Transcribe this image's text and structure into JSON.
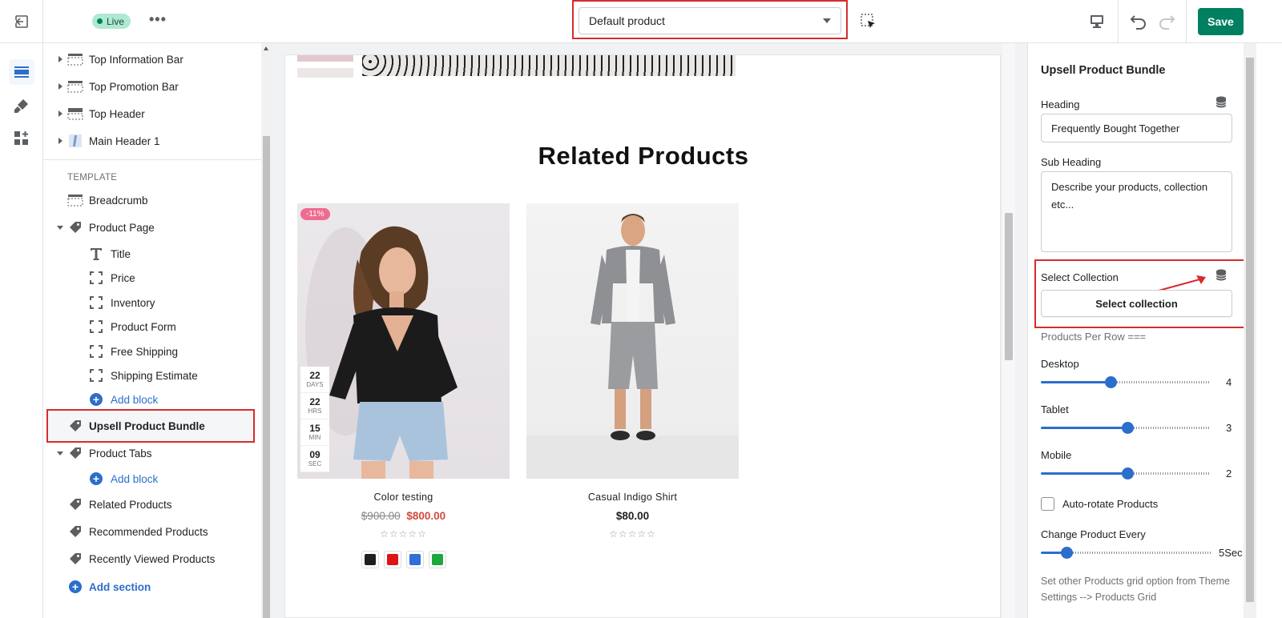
{
  "topbar": {
    "live_label": "Live",
    "more_label": "•••",
    "product_select_value": "Default product",
    "save_label": "Save"
  },
  "sidebar": {
    "header_items": [
      {
        "label": "Top Information Bar"
      },
      {
        "label": "Top Promotion Bar"
      },
      {
        "label": "Top Header"
      },
      {
        "label": "Main Header 1"
      }
    ],
    "template_heading": "TEMPLATE",
    "breadcrumb_label": "Breadcrumb",
    "product_page_label": "Product Page",
    "product_page_blocks": [
      {
        "label": "Title",
        "icon": "text-icon"
      },
      {
        "label": "Price",
        "icon": "block-icon"
      },
      {
        "label": "Inventory",
        "icon": "block-icon"
      },
      {
        "label": "Product Form",
        "icon": "block-icon"
      },
      {
        "label": "Free Shipping",
        "icon": "block-icon"
      },
      {
        "label": "Shipping Estimate",
        "icon": "block-icon"
      }
    ],
    "add_block_label": "Add block",
    "upsell_label": "Upsell Product Bundle",
    "product_tabs_label": "Product Tabs",
    "add_block_label_2": "Add block",
    "related_label": "Related Products",
    "recommended_label": "Recommended Products",
    "recently_viewed_label": "Recently Viewed Products",
    "add_section_label": "Add section"
  },
  "preview": {
    "section_title": "Related Products",
    "products": [
      {
        "name": "Color testing",
        "old_price": "$900.00",
        "price": "$800.00",
        "badge": "-11%",
        "countdown": [
          {
            "num": "22",
            "unit": "DAYS"
          },
          {
            "num": "22",
            "unit": "HRS"
          },
          {
            "num": "15",
            "unit": "MIN"
          },
          {
            "num": "09",
            "unit": "SEC"
          }
        ],
        "stars": "☆☆☆☆☆",
        "swatches": [
          "#1f1f1f",
          "#e01414",
          "#2f6fd6",
          "#1ca83a"
        ]
      },
      {
        "name": "Casual Indigo Shirt",
        "price": "$80.00",
        "stars": "☆☆☆☆☆"
      }
    ]
  },
  "panel": {
    "title": "Upsell Product Bundle",
    "heading_label": "Heading",
    "heading_value": "Frequently Bought Together",
    "subheading_label": "Sub Heading",
    "subheading_value": "Describe your products, collection etc...",
    "select_collection_label": "Select Collection",
    "select_collection_button": "Select collection",
    "products_per_row_label": "Products Per Row ===",
    "desktop_label": "Desktop",
    "desktop_value": "4",
    "tablet_label": "Tablet",
    "tablet_value": "3",
    "mobile_label": "Mobile",
    "mobile_value": "2",
    "autorotate_label": "Auto-rotate Products",
    "change_every_label": "Change Product Every",
    "change_every_value": "5Sec",
    "hint": "Set other Products grid option from Theme Settings --> Products Grid"
  },
  "colors": {
    "accent": "#2c6ecb",
    "save": "#008060",
    "highlight": "#d72c2c",
    "sale_price": "#d14a3c",
    "badge": "#ef6b8f"
  },
  "sliders": {
    "desktop_fraction": 0.41,
    "tablet_fraction": 0.51,
    "mobile_fraction": 0.51,
    "change_every_fraction": 0.15
  }
}
